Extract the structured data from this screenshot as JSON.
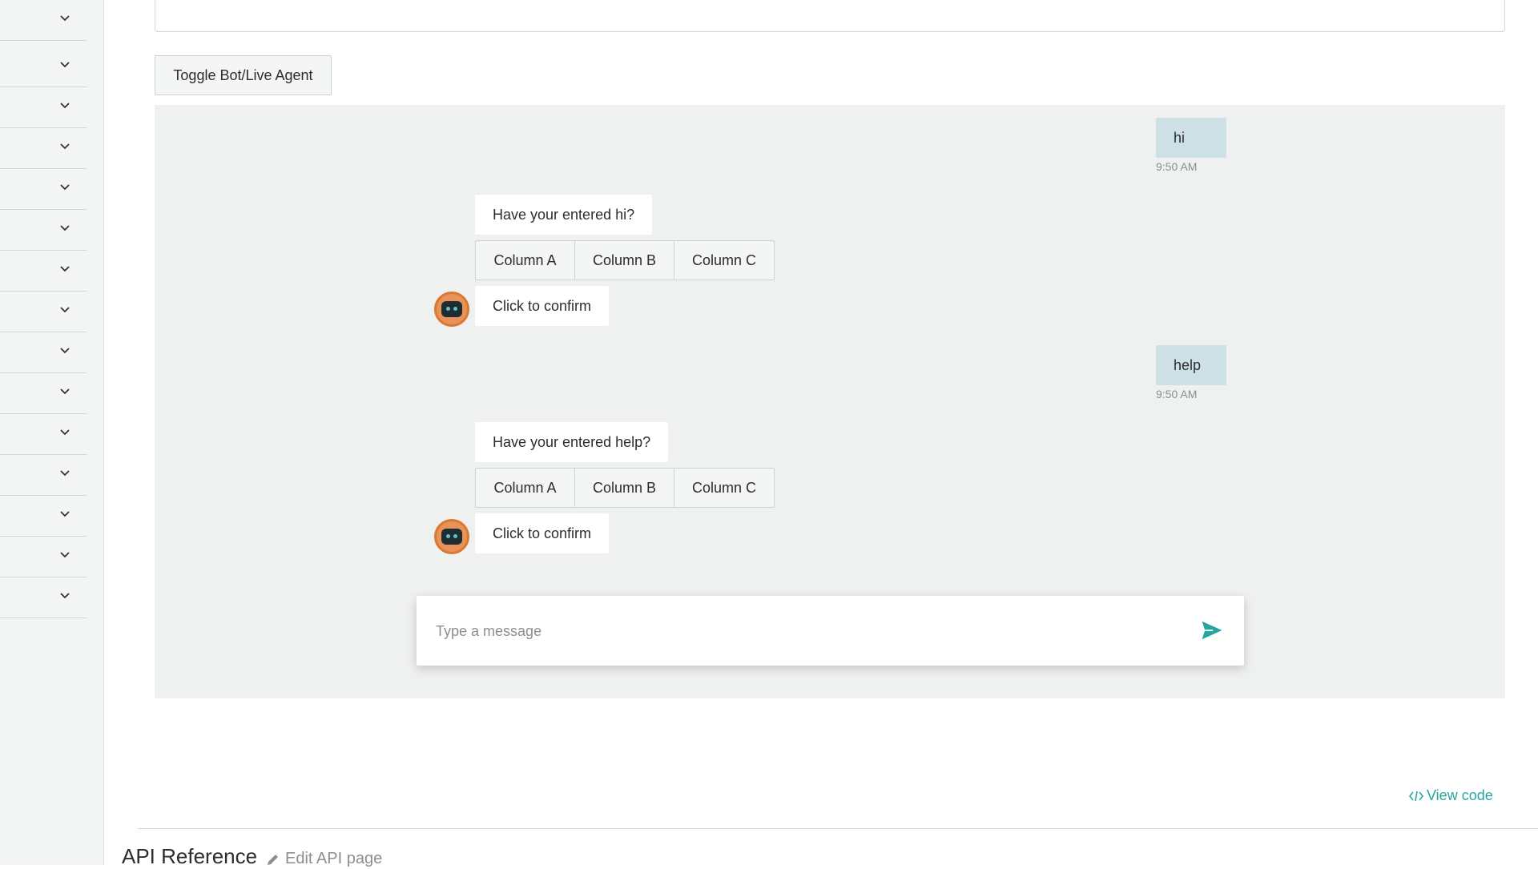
{
  "toolbar": {
    "toggle_label": "Toggle Bot/Live Agent"
  },
  "chat": {
    "messages": [
      {
        "from": "user",
        "text": "hi",
        "time": "9:50 AM"
      },
      {
        "from": "bot",
        "text": "Have your entered hi?",
        "options": [
          "Column A",
          "Column B",
          "Column C"
        ],
        "confirm": "Click to confirm"
      },
      {
        "from": "user",
        "text": "help",
        "time": "9:50 AM"
      },
      {
        "from": "bot",
        "text": "Have your entered help?",
        "options": [
          "Column A",
          "Column B",
          "Column C"
        ],
        "confirm": "Click to confirm"
      }
    ],
    "composer": {
      "placeholder": "Type a message"
    }
  },
  "footer": {
    "view_code": "View code",
    "api_reference": "API Reference",
    "edit_api_page": "Edit API page"
  },
  "colors": {
    "accent": "#27a6a0",
    "user_bubble": "#cde0e6",
    "chat_bg": "#eff0f0"
  },
  "icons": {
    "sidebar_chevron": "chevron-down-icon",
    "send": "send-icon",
    "code": "code-icon",
    "edit": "pencil-icon",
    "bot_avatar": "robot-avatar-icon"
  }
}
